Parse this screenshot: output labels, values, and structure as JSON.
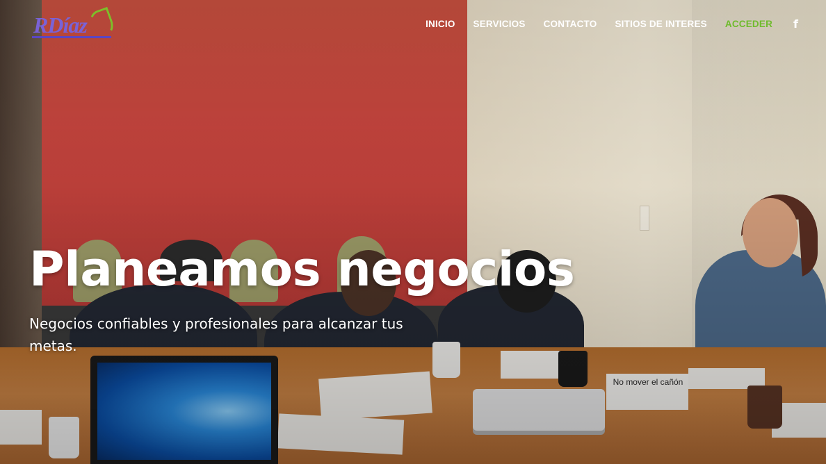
{
  "brand": {
    "logo_text": "RDíaz"
  },
  "nav": {
    "items": [
      {
        "label": "INICIO",
        "active": false
      },
      {
        "label": "SERVICIOS",
        "active": false
      },
      {
        "label": "CONTACTO",
        "active": false
      },
      {
        "label": "SITIOS DE INTERES",
        "active": false
      },
      {
        "label": "ACCEDER",
        "active": true
      }
    ],
    "social_icon": "f"
  },
  "hero": {
    "title": "Planeamos negocios",
    "subtitle": "Negocios confiables y profesionales para alcanzar tus metas.",
    "photo_sign_text": "No mover el cañón"
  },
  "colors": {
    "accent": "#6fbb2d",
    "logo": "#7a62d6"
  }
}
